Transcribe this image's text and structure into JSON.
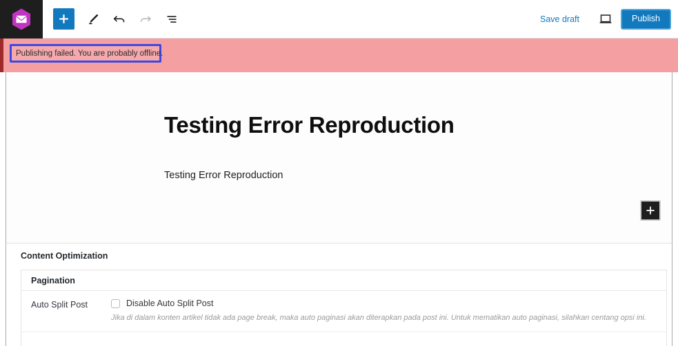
{
  "header": {
    "logo_icon": "purple-hexagon-envelope-logo",
    "tools": [
      {
        "name": "add-block-button",
        "icon": "plus-icon",
        "label": ""
      },
      {
        "name": "tools-pencil-button",
        "icon": "pencil-icon",
        "label": ""
      },
      {
        "name": "undo-button",
        "icon": "undo-arrow-icon",
        "label": ""
      },
      {
        "name": "redo-button",
        "icon": "redo-arrow-icon",
        "label": ""
      },
      {
        "name": "list-view-button",
        "icon": "details-list-icon",
        "label": ""
      }
    ],
    "save_draft_label": "Save draft",
    "preview_icon": "monitor-preview-icon",
    "publish_label": "Publish",
    "accent_color": "#1279be",
    "logo_bg": "#1e1e1e",
    "logo_hex_color": "#c034c0"
  },
  "notice": {
    "message": "Publishing failed. You are probably offline.",
    "bg_color": "#f4a0a3",
    "border_color": "#9e2a2b",
    "highlight_color": "#3b48e0"
  },
  "editor": {
    "post_title": "Testing Error Reproduction",
    "post_paragraph": "Testing Error Reproduction",
    "inserter_icon": "plus-icon"
  },
  "metabox": {
    "title": "Content Optimization",
    "panel": {
      "heading": "Pagination",
      "rows": [
        {
          "label": "Auto Split Post",
          "checkbox_label": "Disable Auto Split Post",
          "checked": false,
          "help": "Jika di dalam konten artikel tidak ada page break, maka auto paginasi akan diterapkan pada post ini. Untuk mematikan auto paginasi, silahkan centang opsi ini."
        }
      ]
    }
  }
}
